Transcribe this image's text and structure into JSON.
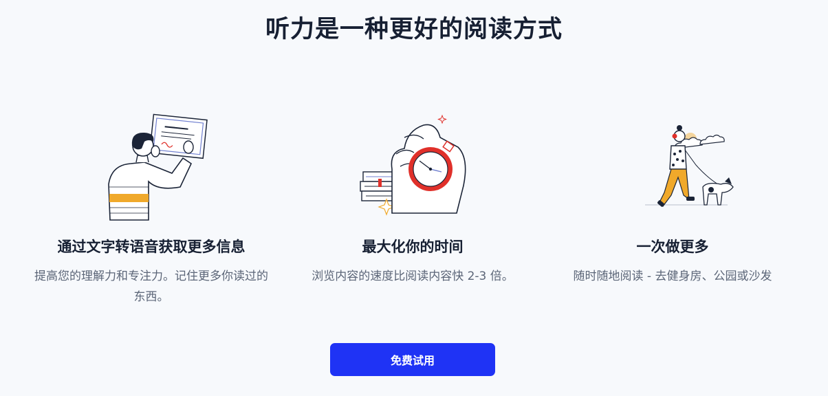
{
  "headline": "听力是一种更好的阅读方式",
  "features": [
    {
      "icon": "certificate-person-illustration",
      "title": "通过文字转语音获取更多信息",
      "description": "提高您的理解力和专注力。记住更多你读过的东西。"
    },
    {
      "icon": "stopwatch-hand-illustration",
      "title": "最大化你的时间",
      "description": "浏览内容的速度比阅读内容快 2-3 倍。"
    },
    {
      "icon": "woman-walking-dog-illustration",
      "title": "一次做更多",
      "description": "随时随地阅读 - 去健身房、公园或沙发"
    }
  ],
  "cta": {
    "label": "免费试用"
  },
  "colors": {
    "background": "#f7f9fc",
    "heading": "#172033",
    "body_text": "#5b6577",
    "cta_background": "#1f33f5",
    "cta_text": "#ffffff",
    "accent_orange": "#f0a92b",
    "accent_red": "#e0302a"
  }
}
